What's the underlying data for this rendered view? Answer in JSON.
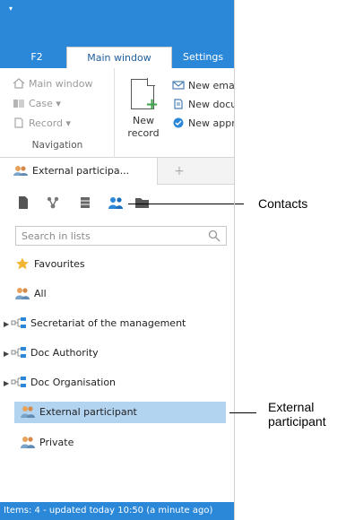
{
  "ribbon_tabs": [
    "F2",
    "Main window",
    "Settings"
  ],
  "navigation": {
    "items": [
      {
        "label": "Main window",
        "icon": "home-icon"
      },
      {
        "label": "Case ▾",
        "icon": "case-icon"
      },
      {
        "label": "Record ▾",
        "icon": "record-icon"
      }
    ],
    "group_label": "Navigation"
  },
  "new_record": {
    "line1": "New",
    "line2": "record"
  },
  "quick_actions": [
    {
      "label": "New ema",
      "icon": "email-icon"
    },
    {
      "label": "New docu",
      "icon": "document-icon"
    },
    {
      "label": "New appr",
      "icon": "approval-icon"
    }
  ],
  "document_tab": {
    "label": "External participa...",
    "add_label": "+"
  },
  "search": {
    "placeholder": "Search in lists"
  },
  "tree": [
    {
      "label": "Favourites",
      "icon": "star-icon",
      "expandable": false
    },
    {
      "label": "All",
      "icon": "contacts-icon",
      "expandable": false
    },
    {
      "label": "Secretariat of the management",
      "icon": "org-unit-icon",
      "expandable": true
    },
    {
      "label": "Doc Authority",
      "icon": "org-unit-icon",
      "expandable": true
    },
    {
      "label": "Doc Organisation",
      "icon": "org-unit-icon",
      "expandable": true
    },
    {
      "label": "External participant",
      "icon": "contacts-icon",
      "expandable": false,
      "selected": true
    },
    {
      "label": "Private",
      "icon": "contacts-icon",
      "expandable": false
    }
  ],
  "status": "Items: 4 - updated today 10:50 (a minute ago)",
  "callouts": {
    "contacts": "Contacts",
    "external_line1": "External",
    "external_line2": "participant"
  },
  "colors": {
    "accent": "#2b88d8",
    "selected": "#b3d4f0"
  }
}
